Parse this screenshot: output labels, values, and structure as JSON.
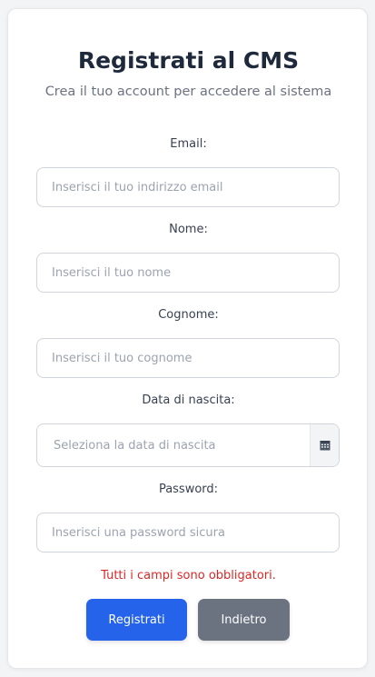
{
  "form": {
    "title": "Registrati al CMS",
    "subtitle": "Crea il tuo account per accedere al sistema",
    "fields": {
      "email": {
        "label": "Email:",
        "placeholder": "Inserisci il tuo indirizzo email",
        "value": ""
      },
      "nome": {
        "label": "Nome:",
        "placeholder": "Inserisci il tuo nome",
        "value": ""
      },
      "cognome": {
        "label": "Cognome:",
        "placeholder": "Inserisci il tuo cognome",
        "value": ""
      },
      "data_nascita": {
        "label": "Data di nascita:",
        "placeholder": "Seleziona la data di nascita",
        "value": "",
        "icon": "calendar-icon"
      },
      "password": {
        "label": "Password:",
        "placeholder": "Inserisci una password sicura",
        "value": ""
      }
    },
    "error_message": "Tutti i campi sono obbligatori.",
    "buttons": {
      "register_label": "Registrati",
      "back_label": "Indietro"
    }
  },
  "colors": {
    "primary": "#2563eb",
    "secondary": "#6b7280",
    "error": "#dc2626",
    "title": "#1e2a3b"
  }
}
